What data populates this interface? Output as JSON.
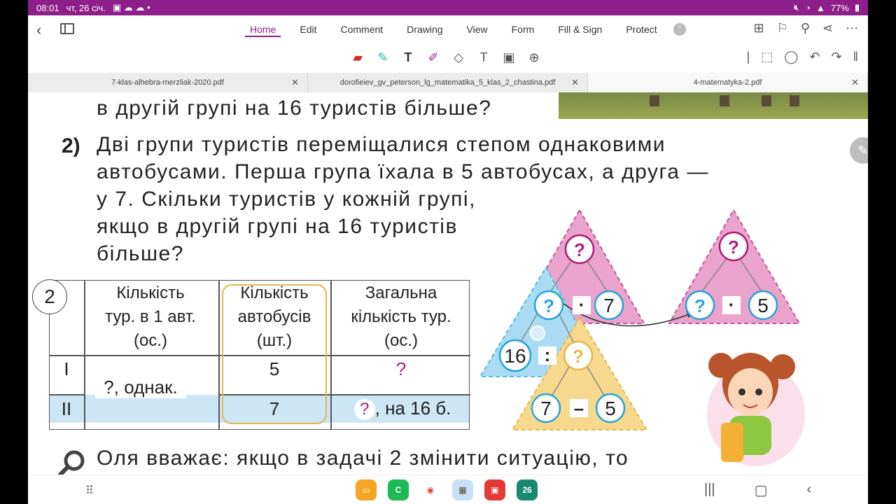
{
  "status": {
    "time": "08:01",
    "date": "чт, 26 січ.",
    "battery": "77%"
  },
  "menu": {
    "items": [
      "Home",
      "Edit",
      "Comment",
      "Drawing",
      "View",
      "Form",
      "Fill & Sign",
      "Protect"
    ],
    "active": "Home"
  },
  "tabs": [
    {
      "label": "7-klas-alhebra-merzliak-2020.pdf"
    },
    {
      "label": "dorofieiev_gv_peterson_lg_matematika_5_klas_2_chastina.pdf"
    },
    {
      "label": "4-matematyka-2.pdf"
    }
  ],
  "doc": {
    "line0": "в другій групі на 16 туристів більше?",
    "num": "2)",
    "p1": "Дві групи туристів переміщалися степом однаковими",
    "p2": "автобусами. Перша група їхала в 5 автобусах, а друга —",
    "p3": "у 7. Скільки туристів у кожній групі,",
    "p4": "якщо в другій групі на 16 туристів",
    "p5": "більше?",
    "table": {
      "circle": "2",
      "h1": [
        "Кількість",
        "тур. в 1 авт.",
        "(ос.)"
      ],
      "h2": [
        "Кількість",
        "автобусів",
        "(шт.)"
      ],
      "h3": [
        "Загальна",
        "кількість тур.",
        "(ос.)"
      ],
      "row1_label": "I",
      "row2_label": "II",
      "shared": "?, однак.",
      "r1_buses": "5",
      "r2_buses": "7",
      "r1_total": "?",
      "r2_total_q": "?",
      "r2_total_rest": ", на 16 б."
    },
    "diagram": {
      "top_q": "?",
      "right_top_q": "?",
      "mid_q": "?",
      "dot": "·",
      "seven": "7",
      "five": "5",
      "sixteen": "16",
      "colon": ":",
      "yellow_q": "?",
      "minus": "–",
      "bottom_seven": "7",
      "bottom_five": "5"
    },
    "bottom": "Оля вважає: якщо в задачі 2 змінити ситуацію, то"
  },
  "colors": {
    "accent": "#8e1f8a",
    "pink": "#e9a3cc",
    "blue": "#a9dcf2",
    "yellow": "#f7d98e",
    "magenta": "#b0187a"
  }
}
